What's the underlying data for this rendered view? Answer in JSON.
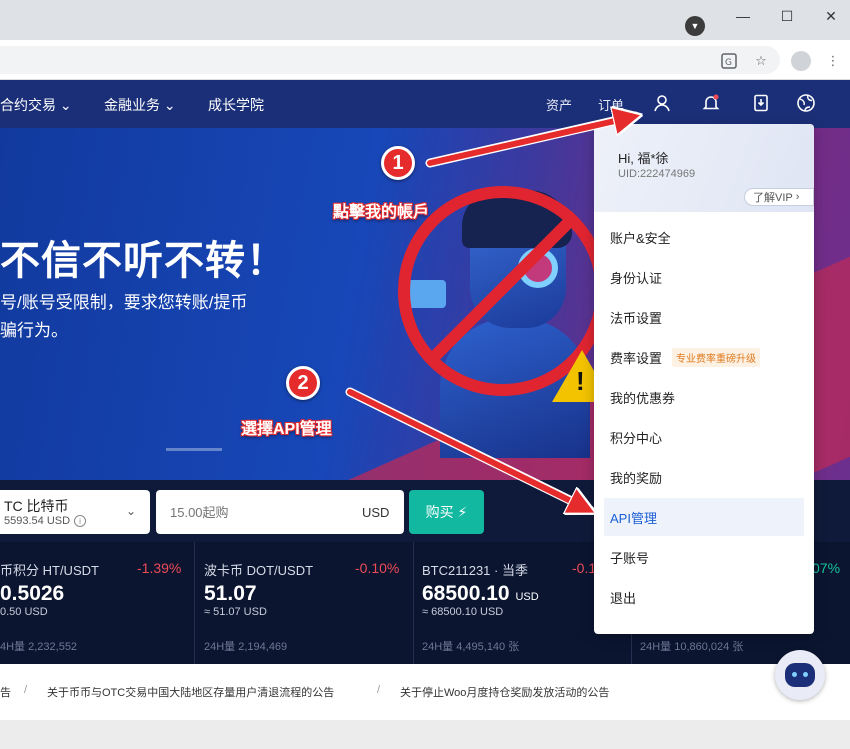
{
  "nav": {
    "items": [
      "合约交易",
      "金融业务",
      "成长学院"
    ],
    "assets": "资产",
    "orders": "订单"
  },
  "hero": {
    "title": "不信不听不转！",
    "subtitle_line1": "号/账号受限制，要求您转账/提币",
    "subtitle_line2": "骗行为。"
  },
  "annotations": {
    "step1_number": "1",
    "step1_text": "點擊我的帳戶",
    "step2_number": "2",
    "step2_text": "選擇API管理"
  },
  "trade": {
    "coin_name": "TC 比特币",
    "coin_price": "5593.54 USD",
    "amount_placeholder": "15.00起购",
    "unit": "USD",
    "buy_label": "购买"
  },
  "tickers": [
    {
      "name": "币积分 HT/USDT",
      "change": "-1.39%",
      "price": "0.5026",
      "price_unit": "",
      "usd": "0.50 USD",
      "volume": "4H量 2,232,552"
    },
    {
      "name": "波卡币 DOT/USDT",
      "change": "-0.10%",
      "price": "51.07",
      "price_unit": "",
      "usd": "≈ 51.07 USD",
      "volume": "24H量 2,194,469"
    },
    {
      "name": "BTC211231 · 当季",
      "change": "-0.1",
      "price": "68500.10",
      "price_unit": "USD",
      "usd": "≈ 68500.10 USD",
      "volume": "24H量 4,495,140 张"
    },
    {
      "name": "",
      "change": "07%",
      "price": "",
      "price_unit": "",
      "usd": "",
      "volume": "24H量 10,860,024 张"
    }
  ],
  "news": [
    "告",
    "关于币币与OTC交易中国大陆地区存量用户清退流程的公告",
    "关于停止Woo月度持仓奖励发放活动的公告"
  ],
  "news_separator": "/",
  "account_menu": {
    "greeting": "Hi, 福*徐",
    "uid": "UID:222474969",
    "vip_link": "了解VIP",
    "items": [
      {
        "label": "账户&安全"
      },
      {
        "label": "身份认证"
      },
      {
        "label": "法币设置"
      },
      {
        "label": "费率设置",
        "tag": "专业费率重磅升级"
      },
      {
        "label": "我的优惠券"
      },
      {
        "label": "积分中心"
      },
      {
        "label": "我的奖励"
      },
      {
        "label": "API管理",
        "active": true
      },
      {
        "label": "子账号"
      },
      {
        "label": "退出"
      }
    ]
  },
  "colors": {
    "nav_bg": "#1b2f78",
    "accent_buy": "#13b8a0",
    "negative": "#ef4b56",
    "annotation_red": "#e52b2b",
    "active_menu": "#1a5ed6"
  }
}
